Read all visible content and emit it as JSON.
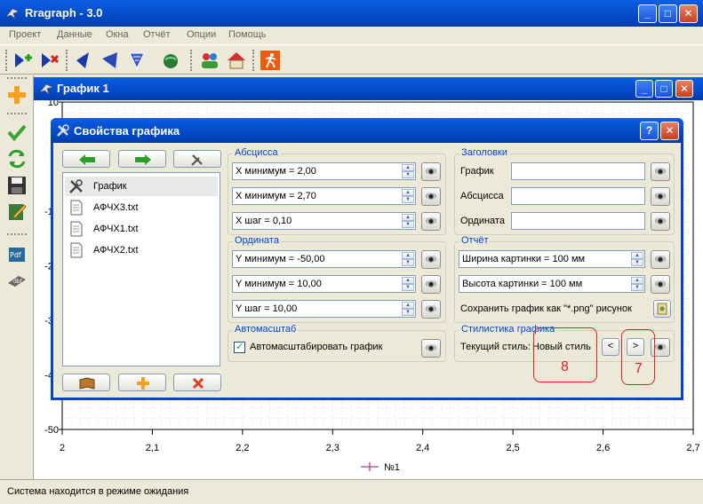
{
  "app": {
    "title": "Rragraph - 3.0"
  },
  "menu": {
    "items": [
      "Проект",
      "Данные",
      "Окна",
      "Отчёт",
      "Опции",
      "Помощь"
    ]
  },
  "child_window": {
    "title": "График 1"
  },
  "chart_data": {
    "type": "line",
    "x_ticks": [
      "2",
      "2,1",
      "2,2",
      "2,3",
      "2,4",
      "2,5",
      "2,6",
      "2,7"
    ],
    "y_ticks": [
      "10",
      "0",
      "-10",
      "-20",
      "-30",
      "-40",
      "-50"
    ],
    "xlim": [
      2.0,
      2.7
    ],
    "ylim": [
      -50,
      10
    ],
    "grid": true,
    "legend": [
      "№1"
    ],
    "series": [
      {
        "name": "№1",
        "color": "#7e4fb0",
        "values": []
      }
    ]
  },
  "dialog": {
    "title": "Свойства графика",
    "list_items": [
      "График",
      "АФЧХ3.txt",
      "АФЧХ1.txt",
      "АФЧХ2.txt"
    ],
    "abscissa": {
      "label": "Абсцисса",
      "fields": [
        "X минимум = 2,00",
        "X минимум = 2,70",
        "X шаг = 0,10"
      ]
    },
    "ordinate": {
      "label": "Ордината",
      "fields": [
        "Y минимум = -50,00",
        "Y минимум = 10,00",
        "Y шаг = 10,00"
      ]
    },
    "autoscale": {
      "label": "Автомасштаб",
      "checkbox_label": "Автомасштабировать график",
      "checked": true
    },
    "headers": {
      "label": "Заголовки",
      "graph": "График",
      "abscissa": "Абсцисса",
      "ordinate": "Ордината"
    },
    "report": {
      "label": "Отчёт",
      "width": "Ширина картинки = 100 мм",
      "height": "Высота картинки = 100 мм",
      "save_png": "Сохранить график как \"*.png\" рисунок"
    },
    "style": {
      "label": "Стилистика графика",
      "current_label": "Текущий стиль:",
      "current_value": "Новый стиль",
      "prev": "<",
      "next": ">"
    }
  },
  "annotations": {
    "box1": "8",
    "box2": "7",
    "color": "#e02020"
  },
  "status": {
    "text": "Система находится в режиме ожидания"
  },
  "colors": {
    "title_blue": "#0650d0",
    "accent_blue": "#0046d5",
    "face": "#ece9d8"
  }
}
